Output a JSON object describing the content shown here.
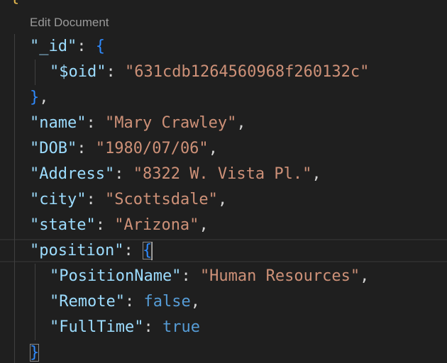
{
  "theme": {
    "background": "#1f1f1f",
    "key": "#9cdcfe",
    "string": "#ce9178",
    "keyword": "#569cd6",
    "punct": "#d4d4d4",
    "bracket": "#2f8bff",
    "gutter": "#e2b64d"
  },
  "codelens": {
    "label": "Edit Document"
  },
  "lines": [
    {
      "parts": [
        {
          "text": "\"_id\"",
          "kind": "key"
        },
        {
          "text": ": ",
          "kind": "punct"
        },
        {
          "text": "{",
          "kind": "bracket"
        }
      ]
    },
    {
      "parts": [
        {
          "text": "\"$oid\"",
          "kind": "key"
        },
        {
          "text": ": ",
          "kind": "punct"
        },
        {
          "text": "\"631cdb1264560968f260132c\"",
          "kind": "string"
        }
      ]
    },
    {
      "parts": [
        {
          "text": "}",
          "kind": "bracket"
        },
        {
          "text": ",",
          "kind": "punct"
        }
      ]
    },
    {
      "parts": [
        {
          "text": "\"name\"",
          "kind": "key"
        },
        {
          "text": ": ",
          "kind": "punct"
        },
        {
          "text": "\"Mary Crawley\"",
          "kind": "string"
        },
        {
          "text": ",",
          "kind": "punct"
        }
      ]
    },
    {
      "parts": [
        {
          "text": "\"DOB\"",
          "kind": "key"
        },
        {
          "text": ": ",
          "kind": "punct"
        },
        {
          "text": "\"1980/07/06\"",
          "kind": "string"
        },
        {
          "text": ",",
          "kind": "punct"
        }
      ]
    },
    {
      "parts": [
        {
          "text": "\"Address\"",
          "kind": "key"
        },
        {
          "text": ": ",
          "kind": "punct"
        },
        {
          "text": "\"8322 W. Vista Pl.\"",
          "kind": "string"
        },
        {
          "text": ",",
          "kind": "punct"
        }
      ]
    },
    {
      "parts": [
        {
          "text": "\"city\"",
          "kind": "key"
        },
        {
          "text": ": ",
          "kind": "punct"
        },
        {
          "text": "\"Scottsdale\"",
          "kind": "string"
        },
        {
          "text": ",",
          "kind": "punct"
        }
      ]
    },
    {
      "parts": [
        {
          "text": "\"state\"",
          "kind": "key"
        },
        {
          "text": ": ",
          "kind": "punct"
        },
        {
          "text": "\"Arizona\"",
          "kind": "string"
        },
        {
          "text": ",",
          "kind": "punct"
        }
      ]
    },
    {
      "parts": [
        {
          "text": "\"position\"",
          "kind": "key"
        },
        {
          "text": ": ",
          "kind": "punct"
        },
        {
          "text": "{",
          "kind": "bracket",
          "match": true
        },
        {
          "text": "",
          "kind": "caret"
        }
      ]
    },
    {
      "parts": [
        {
          "text": "\"PositionName\"",
          "kind": "key"
        },
        {
          "text": ": ",
          "kind": "punct"
        },
        {
          "text": "\"Human Resources\"",
          "kind": "string"
        },
        {
          "text": ",",
          "kind": "punct"
        }
      ]
    },
    {
      "parts": [
        {
          "text": "\"Remote\"",
          "kind": "key"
        },
        {
          "text": ": ",
          "kind": "punct"
        },
        {
          "text": "false",
          "kind": "keyword"
        },
        {
          "text": ",",
          "kind": "punct"
        }
      ]
    },
    {
      "parts": [
        {
          "text": "\"FullTime\"",
          "kind": "key"
        },
        {
          "text": ": ",
          "kind": "punct"
        },
        {
          "text": "true",
          "kind": "keyword"
        }
      ]
    },
    {
      "parts": [
        {
          "text": "}",
          "kind": "bracket",
          "match": true
        }
      ]
    }
  ]
}
